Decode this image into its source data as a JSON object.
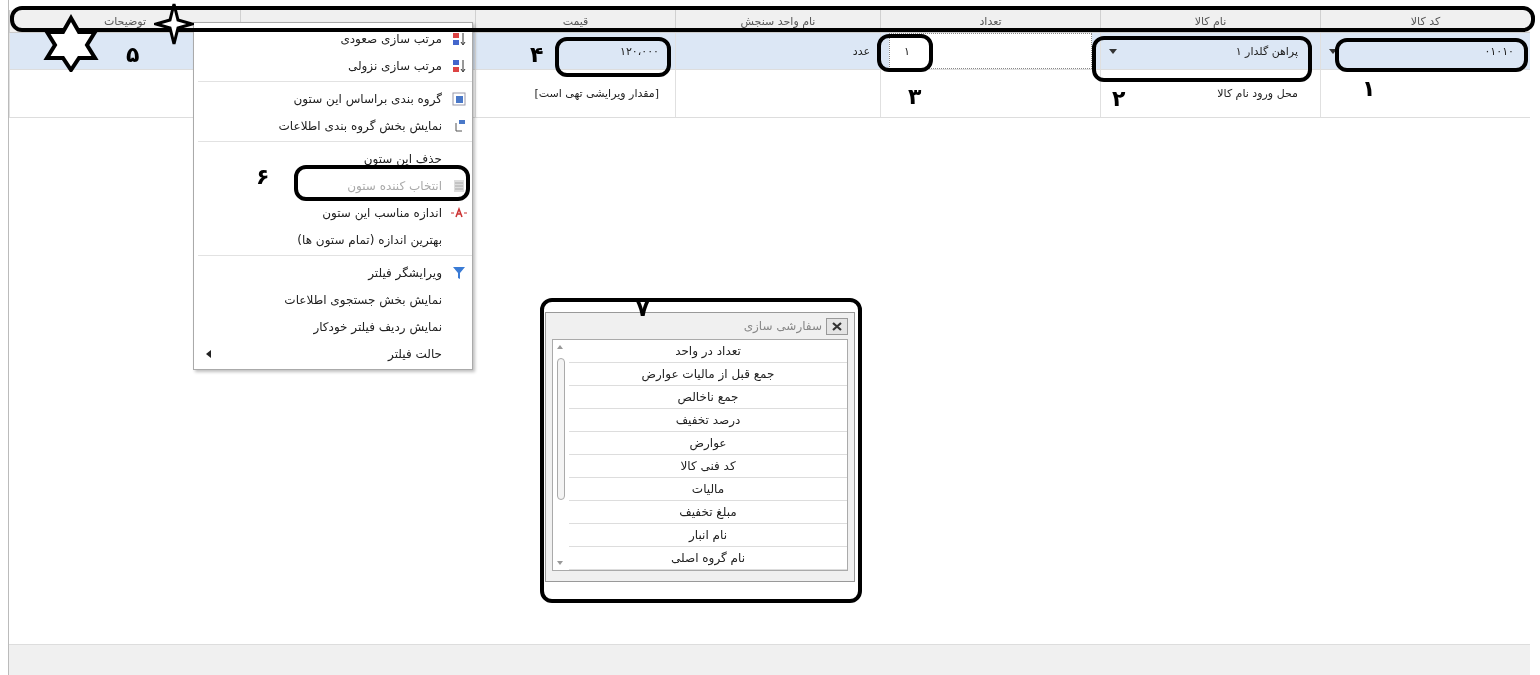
{
  "table": {
    "columns": [
      "کد کالا",
      "نام کالا",
      "تعداد",
      "نام واحد سنجش",
      "قیمت",
      "توضیحات"
    ],
    "rows": [
      {
        "selected": true,
        "cells": [
          {
            "kind": "dropdown",
            "text": "۰۱۰۱۰"
          },
          {
            "kind": "dropdown",
            "text": "پراهن گلدار ۱"
          },
          {
            "kind": "input",
            "text": "۱"
          },
          {
            "kind": "text",
            "text": "عدد"
          },
          {
            "kind": "text",
            "text": "۱۲۰،۰۰۰"
          },
          {
            "kind": "empty"
          }
        ]
      },
      {
        "selected": false,
        "cells": [
          {
            "kind": "empty"
          },
          {
            "kind": "text",
            "text": "محل ورود نام کالا"
          },
          {
            "kind": "empty"
          },
          {
            "kind": "empty"
          },
          {
            "kind": "text",
            "text": "[مقدار ویرایشی تهی است]"
          },
          {
            "kind": "empty"
          }
        ]
      }
    ]
  },
  "context_menu": {
    "items": [
      {
        "kind": "sortasc",
        "label": "مرتب سازی صعودی",
        "disabled": false,
        "submenu": false
      },
      {
        "kind": "sortdesc",
        "label": "مرتب سازی نزولی",
        "disabled": false,
        "submenu": false
      },
      {
        "kind": "separator"
      },
      {
        "kind": "group",
        "label": "گروه بندی براساس این ستون",
        "disabled": false,
        "submenu": false
      },
      {
        "kind": "grouppanel",
        "label": "نمایش بخش گروه بندی اطلاعات",
        "disabled": false,
        "submenu": false
      },
      {
        "kind": "separator"
      },
      {
        "kind": "plain",
        "label": "حذف این ستون",
        "disabled": false,
        "submenu": false
      },
      {
        "kind": "chooser",
        "label": "انتخاب کننده ستون",
        "disabled": true,
        "submenu": false
      },
      {
        "kind": "bestfit",
        "label": "اندازه مناسب این ستون",
        "disabled": false,
        "submenu": false
      },
      {
        "kind": "plain",
        "label": "بهترین اندازه (تمام ستون ها)",
        "disabled": false,
        "submenu": false
      },
      {
        "kind": "separator"
      },
      {
        "kind": "filter",
        "label": "ویرایشگر فیلتر",
        "disabled": false,
        "submenu": false
      },
      {
        "kind": "plain",
        "label": "نمایش بخش جستجوی اطلاعات",
        "disabled": false,
        "submenu": false
      },
      {
        "kind": "plain",
        "label": "نمایش ردیف فیلتر خودکار",
        "disabled": false,
        "submenu": false
      },
      {
        "kind": "plain",
        "label": "حالت فیلتر",
        "disabled": false,
        "submenu": true
      }
    ]
  },
  "customization_dialog": {
    "title": "سفارشی سازی",
    "items": [
      "تعداد در واحد",
      "جمع قبل از مالیات عوارض",
      "جمع ناخالص",
      "درصد تخفیف",
      "عوارض",
      "کد فنی کالا",
      "مالیات",
      "مبلغ تخفیف",
      "نام انبار",
      "نام گروه اصلی"
    ]
  },
  "annotations": [
    "۱",
    "۲",
    "۳",
    "۴",
    "۵",
    "۶",
    "۷"
  ]
}
